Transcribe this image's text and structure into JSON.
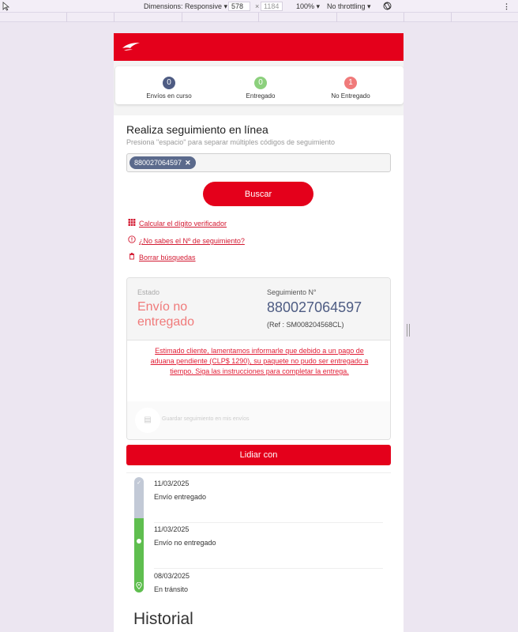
{
  "devtools": {
    "dimensions_label": "Dimensions: Responsive",
    "width": "578",
    "height": "1184",
    "zoom": "100%",
    "throttle": "No throttling"
  },
  "stats": [
    {
      "count": "0",
      "label": "Envíos en curso",
      "color": "#4e5c83"
    },
    {
      "count": "0",
      "label": "Entregado",
      "color": "#8cd07d"
    },
    {
      "count": "1",
      "label": "No Entregado",
      "color": "#f07a7a"
    }
  ],
  "search": {
    "title": "Realiza seguimiento en línea",
    "hint": "Presiona \"espacio\" para separar múltiples códigos de seguimiento",
    "chip": "880027064597",
    "button": "Buscar"
  },
  "links": {
    "calc": "Calcular el dígito verificador",
    "unknown": "¿No sabes el Nº de seguimiento?",
    "clear": "Borrar búsquedas"
  },
  "result": {
    "estado_label": "Estado",
    "estado_value": "Envío no entregado",
    "seg_label": "Seguimiento N°",
    "seg_value": "880027064597",
    "ref": "(Ref : SM008204568CL)",
    "message": "Estimado cliente, lamentamos informarle que debido a un pago de aduana pendiente (CLP$ 1290), su paquete no pudo ser entregado a tiempo. Siga las instrucciones para completar la entrega.",
    "save_label": "Guardar seguimiento en mis envíos"
  },
  "action_button": "Lidiar con",
  "events": [
    {
      "date": "11/03/2025",
      "status": "Envío entregado"
    },
    {
      "date": "11/03/2025",
      "status": "Envío no entregado"
    },
    {
      "date": "08/03/2025",
      "status": "En tránsito"
    }
  ],
  "historial": "Historial",
  "colors": {
    "brand": "#e4001b",
    "timeline_done": "#c2c9d6",
    "timeline_active": "#5fbe4f"
  }
}
